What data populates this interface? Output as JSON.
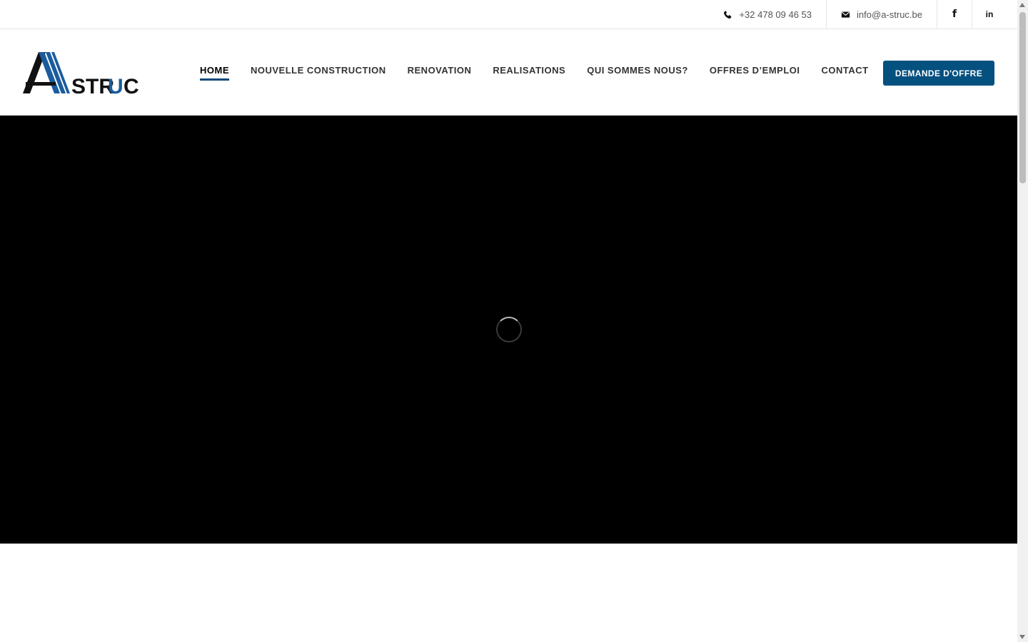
{
  "topbar": {
    "phone": "+32 478 09 46 53",
    "email": "info@a-struc.be",
    "icons": {
      "phone": "phone-icon",
      "email": "envelope-icon",
      "facebook": "facebook-icon",
      "linkedin": "linkedin-icon"
    },
    "facebook_glyph": "f",
    "linkedin_glyph": "in"
  },
  "header": {
    "logo_text": {
      "letter_a": "A",
      "struc": "STR",
      "u": "U",
      "c": "C"
    },
    "nav": [
      {
        "label": "HOME",
        "active": true
      },
      {
        "label": "NOUVELLE CONSTRUCTION"
      },
      {
        "label": "RENOVATION"
      },
      {
        "label": "REALISATIONS"
      },
      {
        "label": "QUI SOMMES NOUS?"
      },
      {
        "label": "OFFRES D’EMPLOI"
      },
      {
        "label": "CONTACT"
      }
    ],
    "cta_label": "DEMANDE D'OFFRE"
  },
  "hero": {
    "state": "loading",
    "icon": "loading-spinner-icon"
  },
  "colors": {
    "brand": "#04507f",
    "accent_blue": "#1a5c9e",
    "hero_bg": "#000000",
    "text": "#333333"
  }
}
